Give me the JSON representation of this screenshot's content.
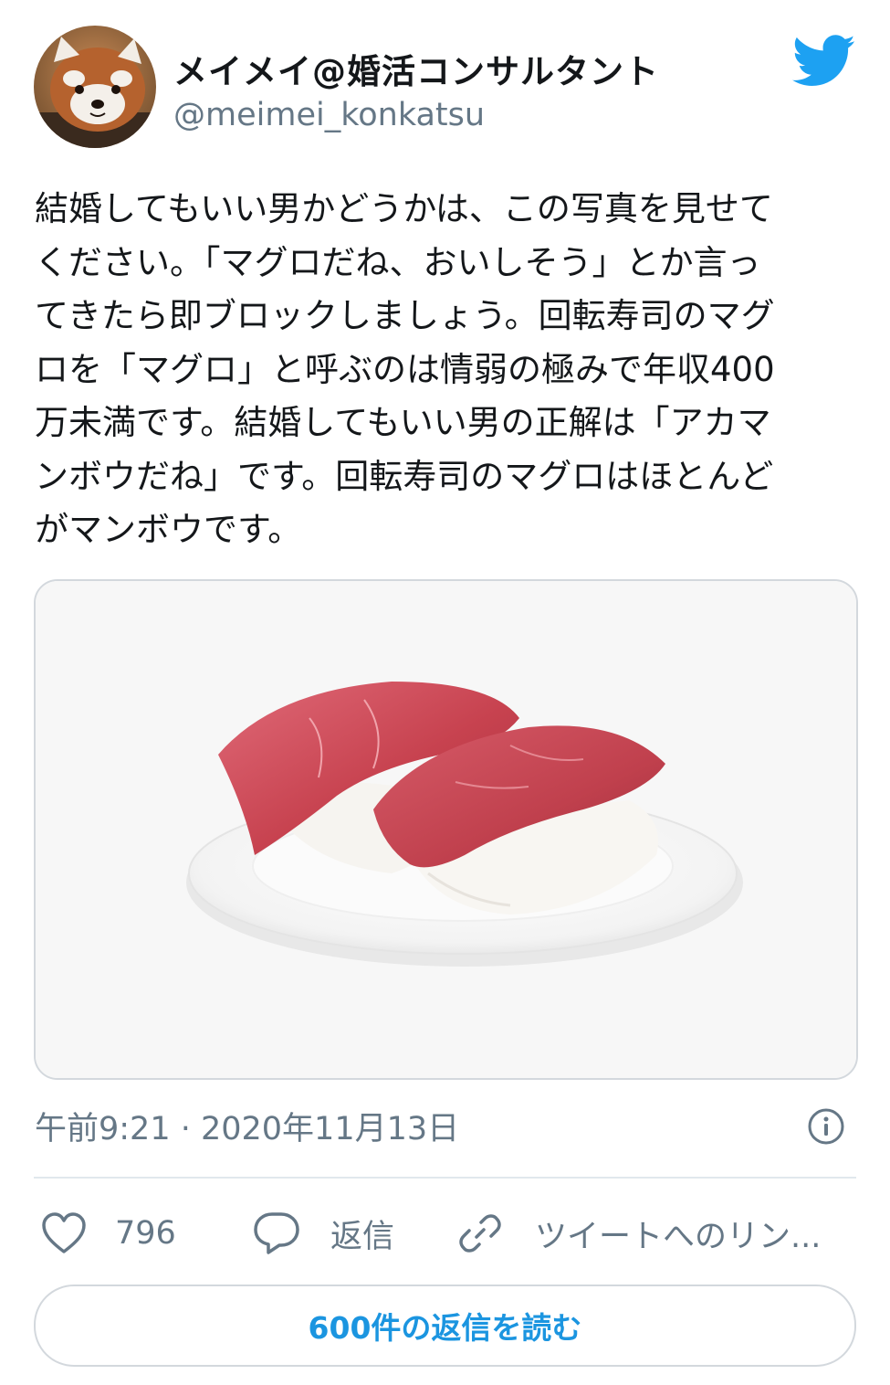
{
  "tweet": {
    "display_name": "メイメイ@婚活コンサルタント",
    "handle": "@meimei_konkatsu",
    "text_lines": [
      "結婚してもいい男かどうかは、この写真を見せて",
      "ください。「マグロだね、おいしそう」とか言っ",
      "てきたら即ブロックしましょう。回転寿司のマグ",
      "ロを「マグロ」と呼ぶのは情弱の極みで年収400",
      "万未満です。結婚してもいい男の正解は「アカマ",
      "ンボウだね」です。回転寿司のマグロはほとんど",
      "がマンボウです。"
    ],
    "timestamp": "午前9:21 · 2020年11月13日"
  },
  "actions": {
    "like_count": "796",
    "reply_label": "返信",
    "link_label": "ツイートへのリン..."
  },
  "read_replies_label": "600件の返信を読む",
  "icons": {
    "twitter": "twitter-bird-icon",
    "info": "info-icon",
    "like": "heart-icon",
    "reply": "speech-bubble-icon",
    "link": "chain-link-icon"
  },
  "colors": {
    "brand_blue": "#1da1f2",
    "link_blue": "#1b95e0",
    "secondary_text": "#657786",
    "border": "#d3d8dd"
  }
}
